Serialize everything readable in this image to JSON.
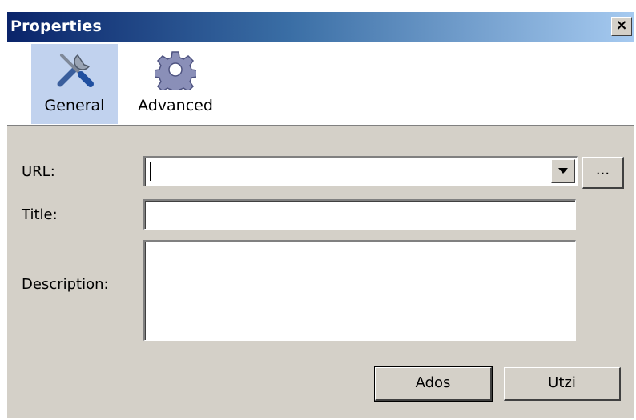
{
  "window": {
    "title": "Properties",
    "close_label": "×"
  },
  "tabs": [
    {
      "label": "General",
      "icon": "tools-icon",
      "selected": true
    },
    {
      "label": "Advanced",
      "icon": "gear-icon",
      "selected": false
    }
  ],
  "form": {
    "url_label": "URL:",
    "url_value": "",
    "browse_label": "...",
    "title_label": "Title:",
    "title_value": "",
    "description_label": "Description:",
    "description_value": ""
  },
  "buttons": {
    "ok_label": "Ados",
    "cancel_label": "Utzi"
  },
  "colors": {
    "selected_tab": "#c1d2ee",
    "titlebar_start": "#0a246a",
    "titlebar_end": "#a6caf0",
    "dialog_bg": "#d4d0c8"
  }
}
